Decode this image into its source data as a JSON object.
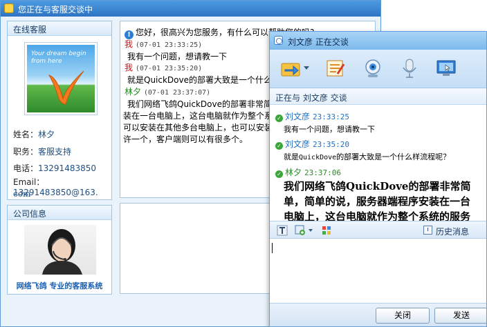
{
  "web": {
    "title": "您正在与客服交谈中",
    "service_panel": {
      "title": "在线客服",
      "photo_text_1": "Your dream begin",
      "photo_text_2": "from here",
      "name_label": "姓名：",
      "name": "林夕",
      "role_label": "职务：",
      "role": "客服支持",
      "phone_label": "电话：",
      "phone": "13291483850",
      "email_label": "Email：",
      "email_1": "13291483850@163.",
      "email_2": "com"
    },
    "company_panel": {
      "title": "公司信息",
      "slogan": "网络飞鸽 专业的客服系统"
    },
    "chat": {
      "greeting": "您好，很高兴为您服务，有什么可以帮助您的吗?",
      "messages": [
        {
          "sender": "我",
          "time": "(07-01 23:33:25)",
          "lines": [
            "我有一个问题，想请教一下"
          ]
        },
        {
          "sender": "我",
          "time": "(07-01 23:35:20)",
          "lines": [
            "就是QuickDove的部署大致是一个什么样流程呢？"
          ]
        },
        {
          "sender": "林夕",
          "time": "(07-01 23:37:07)",
          "lines": [
            "我们网络飞鸽QuickDove的部署非常简单，简单的说，服务器端程序安",
            "装在一台电脑上，这台电脑就作为整个系统的服务中心，然后，客户端",
            "可以安装在其他多台电脑上，也可以安装在服务器端这台电脑上，服务器端只允",
            "许一个，客户端则可以有很多个。"
          ]
        }
      ]
    }
  },
  "qq": {
    "title": "刘文彦  正在交谈",
    "status": "正在与 刘文彦 交谈",
    "tools": [
      "transfer-file-icon",
      "whiteboard-icon",
      "webcam-icon",
      "microphone-icon",
      "screen-share-icon"
    ],
    "messages": [
      {
        "sender": "刘文彦",
        "time": "23:33:25",
        "text": "我有一个问题，想请教一下"
      },
      {
        "sender": "刘文彦",
        "time": "23:35:20",
        "text_pre": "就是",
        "text_mono": "QuickDove",
        "text_post": "的部署大致是一个什么样流程呢？"
      },
      {
        "sender": "林夕",
        "time": "23:37:06",
        "lines": [
          "我们网络飞鸽QuickDove的部署非常简",
          "单，简单的说，服务器端程序安装在一台",
          "电脑上，这台电脑就作为整个系统的服务"
        ]
      }
    ],
    "history_label": "历史消息",
    "close_label": "关闭",
    "send_label": "发送"
  },
  "colors": {
    "accent": "#2d74c4",
    "me": "#d01010",
    "other": "#1b8a1b"
  }
}
